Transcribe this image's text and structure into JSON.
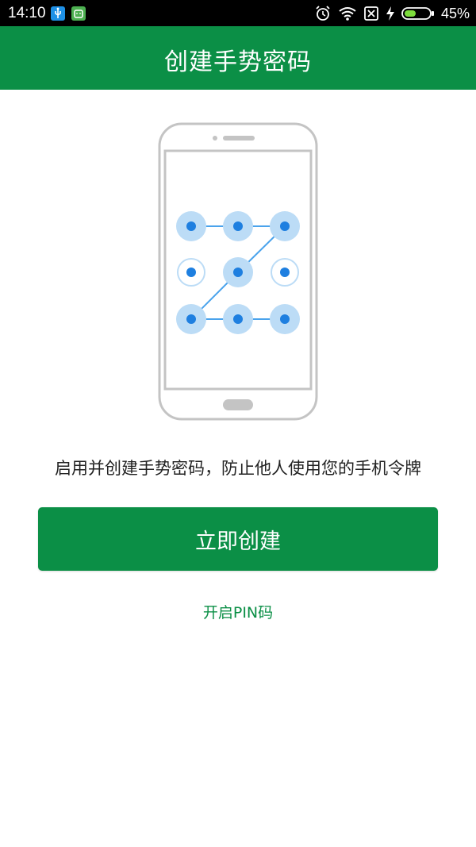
{
  "status_bar": {
    "time": "14:10",
    "battery_percent": "45%",
    "icons": [
      "usb-debug-icon",
      "android-icon",
      "alarm-icon",
      "wifi-icon",
      "no-sim-icon",
      "charging-icon",
      "battery-icon"
    ],
    "battery_level": 0.45
  },
  "app_bar": {
    "title": "创建手势密码"
  },
  "illustration": {
    "icon": "phone-pattern-lock-icon"
  },
  "main": {
    "description": "启用并创建手势密码，防止他人使用您的手机令牌",
    "create_button_label": "立即创建",
    "pin_link_label": "开启PIN码"
  },
  "colors": {
    "brand_green": "#0b8f46",
    "pattern_blue": "#1e88e5",
    "pattern_light_blue": "#bbdefb"
  }
}
